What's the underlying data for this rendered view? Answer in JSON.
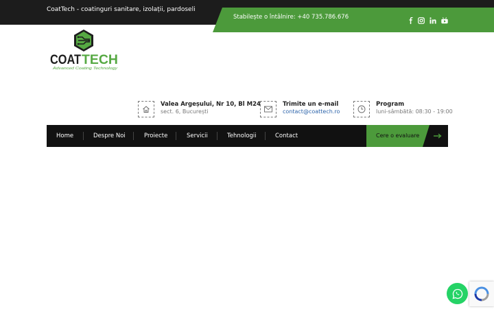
{
  "topbar": {
    "tagline": "CoatTech - coatinguri sanitare, izolații, pardoseli",
    "appointment": "Stabilește o întâlnire: +40 735.786.676"
  },
  "social": [
    {
      "icon": "facebook-icon"
    },
    {
      "icon": "instagram-icon"
    },
    {
      "icon": "linkedin-icon"
    },
    {
      "icon": "youtube-icon"
    }
  ],
  "logo": {
    "wordmark": "COATTECH",
    "tagline": "Advanced Coating Technology"
  },
  "info": {
    "address": {
      "icon": "home-icon",
      "title": "Valea Argeșului, Nr 10, Bl M24",
      "sub": "sect. 6, București"
    },
    "email": {
      "icon": "envelope-icon",
      "title": "Trimite un e-mail",
      "sub": "contact@coattech.ro"
    },
    "hours": {
      "icon": "clock-icon",
      "title": "Program",
      "sub": "luni-sâmbătă: 08:30 - 19:00"
    }
  },
  "nav": {
    "items": [
      "Home",
      "Despre Noi",
      "Proiecte",
      "Servicii",
      "Tehnologii",
      "Contact"
    ],
    "cta": "Cere o evaluare"
  },
  "colors": {
    "accent": "#4c9a3b",
    "dark": "#111111",
    "topbar": "#1c1c1c",
    "link": "#2a62a9"
  }
}
